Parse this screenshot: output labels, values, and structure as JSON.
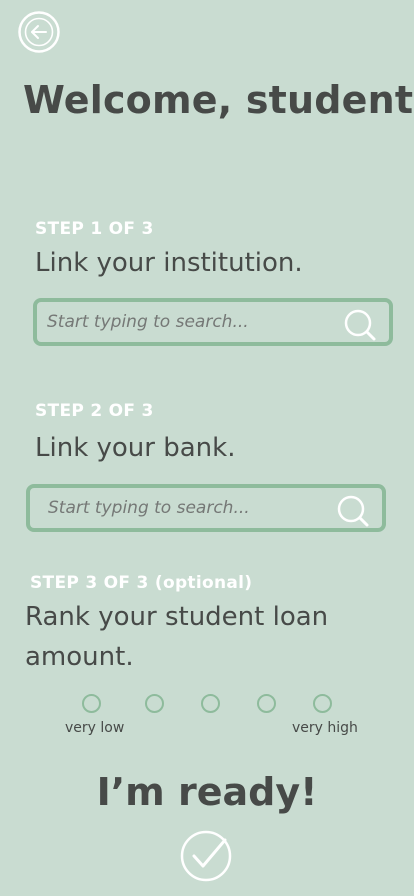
{
  "header": {
    "title": "Welcome, student!"
  },
  "steps": [
    {
      "label": "STEP 1 OF 3",
      "heading": "Link your institution.",
      "search_placeholder": "Start typing to search..."
    },
    {
      "label": "STEP 2 OF 3",
      "heading": "Link your bank.",
      "search_placeholder": "Start typing to search..."
    },
    {
      "label": "STEP 3 OF 3 (optional)",
      "heading": "Rank your student loan amount.",
      "scale": {
        "low_label": "very low",
        "high_label": "very high",
        "options": 5,
        "selected": null
      }
    }
  ],
  "footer": {
    "ready_label": "I’m ready!"
  },
  "icons": {
    "back": "back-arrow-icon",
    "search": "search-icon",
    "confirm": "checkmark-icon"
  },
  "colors": {
    "background": "#c9dcd1",
    "accent": "#8ebb9c",
    "text": "#474a48",
    "step_label": "#ffffff"
  }
}
